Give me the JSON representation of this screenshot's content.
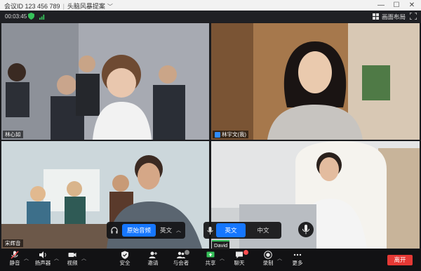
{
  "titlebar": {
    "meeting_id": "会议ID 123 456 789",
    "topic": "头脑风暴提案"
  },
  "infobar": {
    "elapsed": "00:03:45",
    "layout_label": "画面布局"
  },
  "participants": [
    {
      "name": "林心如"
    },
    {
      "name": "林宇文(我)"
    },
    {
      "name": "宋辉音"
    },
    {
      "name": ""
    }
  ],
  "interpretation": {
    "original_audio": "原始音频",
    "channel": "英文",
    "languages": [
      "英文",
      "中文"
    ],
    "active_language": "英文"
  },
  "speaker_tooltip": "David",
  "toolbar": {
    "items": [
      {
        "label": "静音",
        "icon": "mic-muted-icon"
      },
      {
        "label": "扬声器",
        "icon": "speaker-icon"
      },
      {
        "label": "视频",
        "icon": "video-icon"
      },
      {
        "label": "安全",
        "icon": "shield-icon"
      },
      {
        "label": "邀请",
        "icon": "invite-icon"
      },
      {
        "label": "与会者",
        "icon": "participants-icon"
      },
      {
        "label": "共享",
        "icon": "share-icon"
      },
      {
        "label": "聊天",
        "icon": "chat-icon"
      },
      {
        "label": "录制",
        "icon": "record-icon"
      },
      {
        "label": "更多",
        "icon": "more-icon"
      }
    ],
    "end_label": "离开"
  },
  "colors": {
    "accent": "#1677ff",
    "end": "#e53935",
    "share_green": "#36c25a",
    "badge": "#ff4d4f"
  }
}
